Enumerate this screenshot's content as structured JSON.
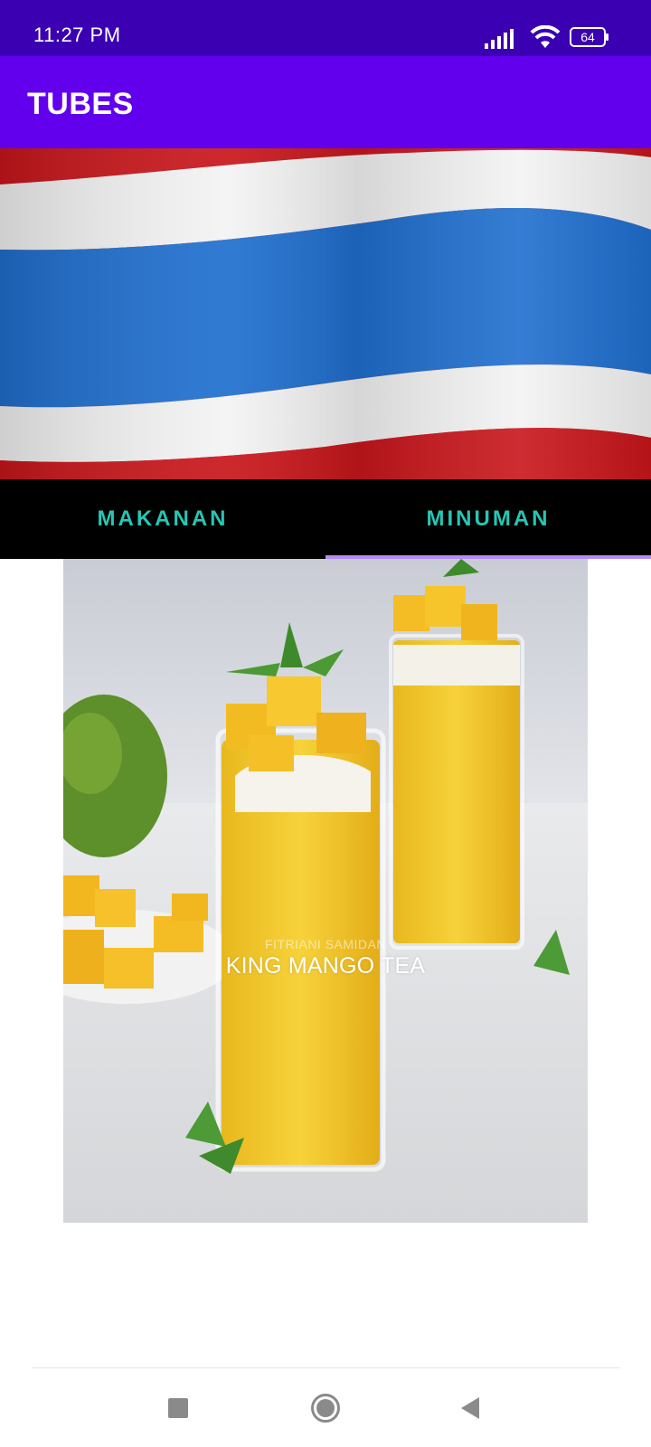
{
  "status_bar": {
    "time": "11:27 PM",
    "battery": "64",
    "icons": [
      "signal-icon",
      "wifi-icon",
      "battery-icon"
    ]
  },
  "app_bar": {
    "title": "TUBES"
  },
  "banner": {
    "image": "thailand-flag"
  },
  "tabs": {
    "items": [
      {
        "label": "MAKANAN",
        "selected": false
      },
      {
        "label": "MINUMAN",
        "selected": true
      }
    ]
  },
  "card": {
    "watermark": "FITRIANI SAMIDAN",
    "caption": "KING MANGO TEA"
  },
  "nav_bar": {
    "icons": [
      "recent-apps-icon",
      "home-icon",
      "back-icon"
    ]
  },
  "colors": {
    "status_bar": "#3a00b2",
    "app_bar": "#6200ee",
    "tab_text": "#26c6b4",
    "tab_indicator": "#b38cf5"
  }
}
